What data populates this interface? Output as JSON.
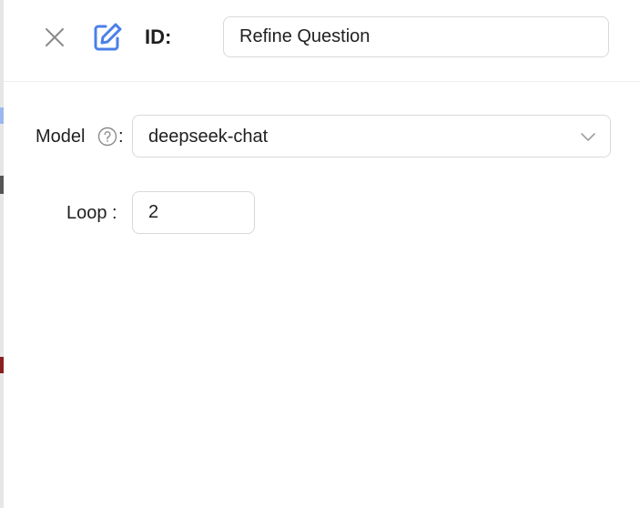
{
  "header": {
    "id_label": "ID:",
    "title_value": "Refine Question"
  },
  "form": {
    "model": {
      "label": "Model",
      "colon": ":",
      "selected": "deepseek-chat",
      "help_icon": "question-circle-icon"
    },
    "loop": {
      "label": "Loop :",
      "value": "2"
    }
  },
  "icons": {
    "close": "close-icon",
    "edit": "edit-icon",
    "dropdown": "chevron-down-icon"
  },
  "colors": {
    "accent": "#4a80e8",
    "border": "#d9d9d9",
    "icon_gray": "#8a8a8a",
    "text": "#1f1f1f"
  }
}
